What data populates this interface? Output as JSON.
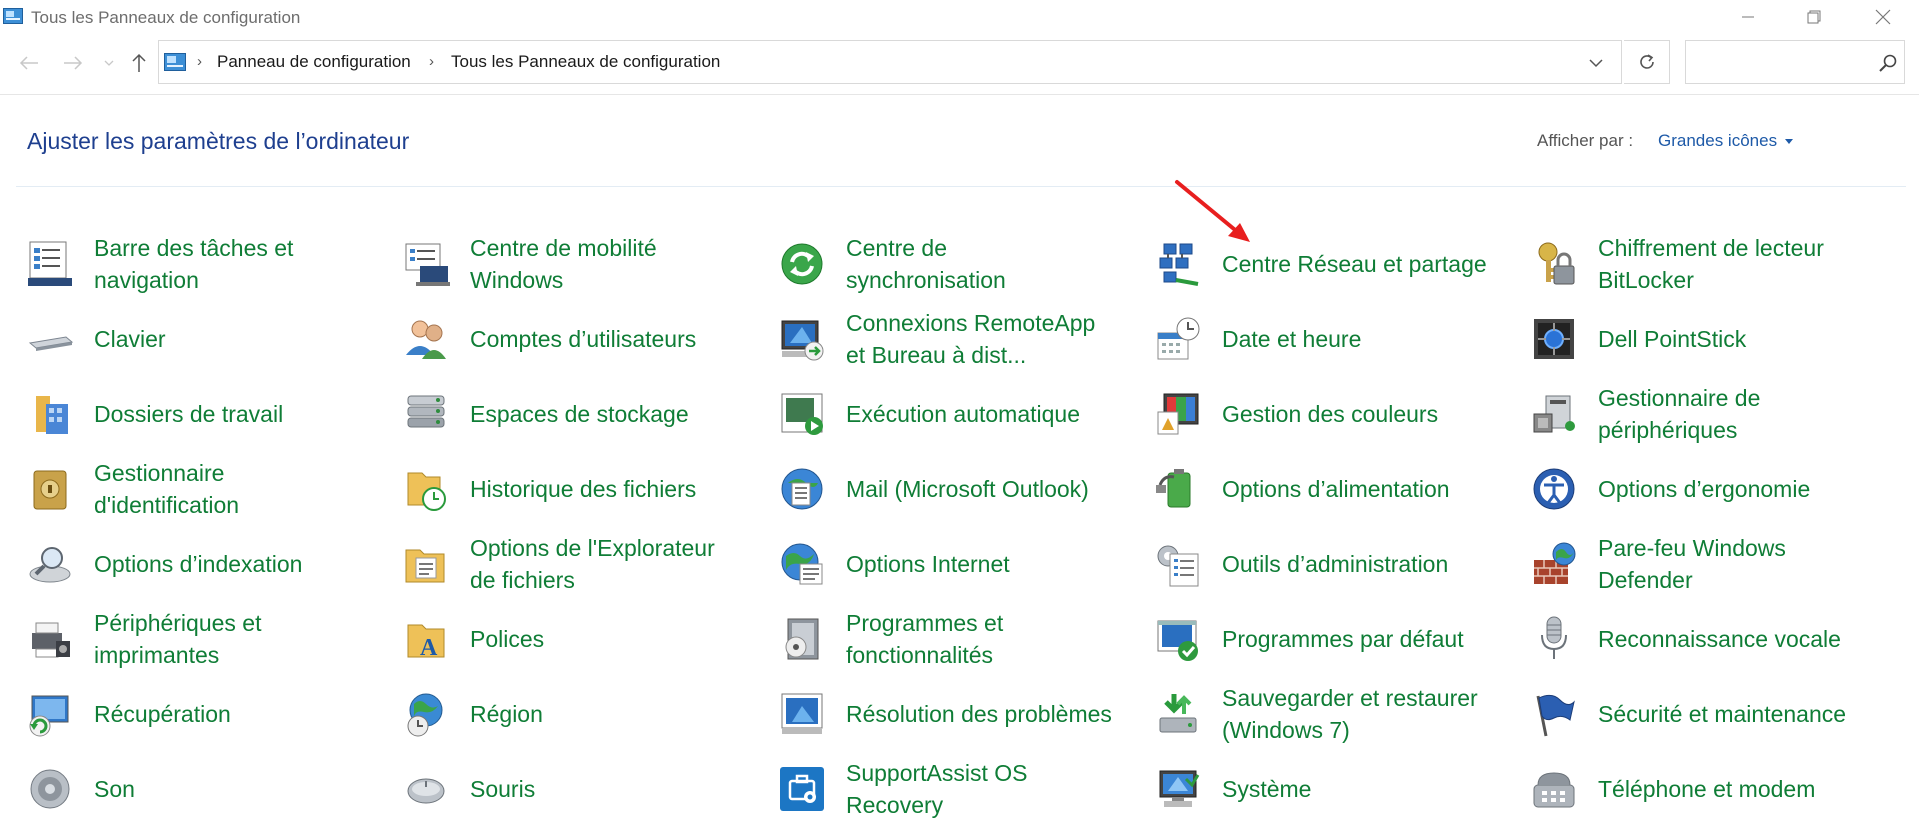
{
  "window": {
    "title": "Tous les Panneaux de configuration"
  },
  "address": {
    "crumbs": [
      "Panneau de configuration",
      "Tous les Panneaux de configuration"
    ],
    "search_placeholder": ""
  },
  "header": {
    "title": "Ajuster les paramètres de l’ordinateur",
    "view_by_label": "Afficher par :",
    "view_by_value": "Grandes icônes"
  },
  "colors": {
    "link_green": "#0f7d36",
    "title_blue": "#1e3f8f",
    "annotation_red": "#e81f1f"
  },
  "columns": [
    {
      "items": [
        {
          "label": "Barre des tâches et navigation",
          "icon": "taskbar-icon"
        },
        {
          "label": "Clavier",
          "icon": "keyboard-icon"
        },
        {
          "label": "Dossiers de travail",
          "icon": "work-folders-icon"
        },
        {
          "label": "Gestionnaire d'identification",
          "icon": "credential-manager-icon"
        },
        {
          "label": "Options d’indexation",
          "icon": "indexing-icon"
        },
        {
          "label": "Périphériques et imprimantes",
          "icon": "printer-icon"
        },
        {
          "label": "Récupération",
          "icon": "recovery-icon"
        },
        {
          "label": "Son",
          "icon": "speaker-icon"
        }
      ]
    },
    {
      "items": [
        {
          "label": "Centre de mobilité Windows",
          "icon": "mobility-icon"
        },
        {
          "label": "Comptes d’utilisateurs",
          "icon": "users-icon"
        },
        {
          "label": "Espaces de stockage",
          "icon": "storage-icon"
        },
        {
          "label": "Historique des fichiers",
          "icon": "file-history-icon"
        },
        {
          "label": "Options de l'Explorateur de fichiers",
          "icon": "explorer-options-icon"
        },
        {
          "label": "Polices",
          "icon": "fonts-icon"
        },
        {
          "label": "Région",
          "icon": "region-icon"
        },
        {
          "label": "Souris",
          "icon": "mouse-icon"
        }
      ]
    },
    {
      "items": [
        {
          "label": "Centre de synchronisation",
          "icon": "sync-icon"
        },
        {
          "label": "Connexions RemoteApp et Bureau à dist...",
          "icon": "remoteapp-icon"
        },
        {
          "label": "Exécution automatique",
          "icon": "autoplay-icon"
        },
        {
          "label": "Mail (Microsoft Outlook)",
          "icon": "mail-icon"
        },
        {
          "label": "Options Internet",
          "icon": "internet-options-icon"
        },
        {
          "label": "Programmes et fonctionnalités",
          "icon": "programs-icon"
        },
        {
          "label": "Résolution des problèmes",
          "icon": "troubleshoot-icon"
        },
        {
          "label": "SupportAssist OS Recovery",
          "icon": "supportassist-icon"
        }
      ]
    },
    {
      "items": [
        {
          "label": "Centre Réseau et partage",
          "icon": "network-icon"
        },
        {
          "label": "Date et heure",
          "icon": "clock-icon"
        },
        {
          "label": "Gestion des couleurs",
          "icon": "color-management-icon"
        },
        {
          "label": "Options d’alimentation",
          "icon": "power-icon"
        },
        {
          "label": "Outils d’administration",
          "icon": "admin-tools-icon"
        },
        {
          "label": "Programmes par défaut",
          "icon": "default-programs-icon"
        },
        {
          "label": "Sauvegarder et restaurer (Windows 7)",
          "icon": "backup-icon"
        },
        {
          "label": "Système",
          "icon": "system-icon"
        }
      ]
    },
    {
      "items": [
        {
          "label": "Chiffrement de lecteur BitLocker",
          "icon": "bitlocker-icon"
        },
        {
          "label": "Dell PointStick",
          "icon": "pointstick-icon"
        },
        {
          "label": "Gestionnaire de périphériques",
          "icon": "device-manager-icon"
        },
        {
          "label": "Options d’ergonomie",
          "icon": "ease-of-access-icon"
        },
        {
          "label": "Pare-feu Windows Defender",
          "icon": "firewall-icon"
        },
        {
          "label": "Reconnaissance vocale",
          "icon": "microphone-icon"
        },
        {
          "label": "Sécurité et maintenance",
          "icon": "flag-icon"
        },
        {
          "label": "Téléphone et modem",
          "icon": "phone-icon"
        }
      ]
    }
  ]
}
